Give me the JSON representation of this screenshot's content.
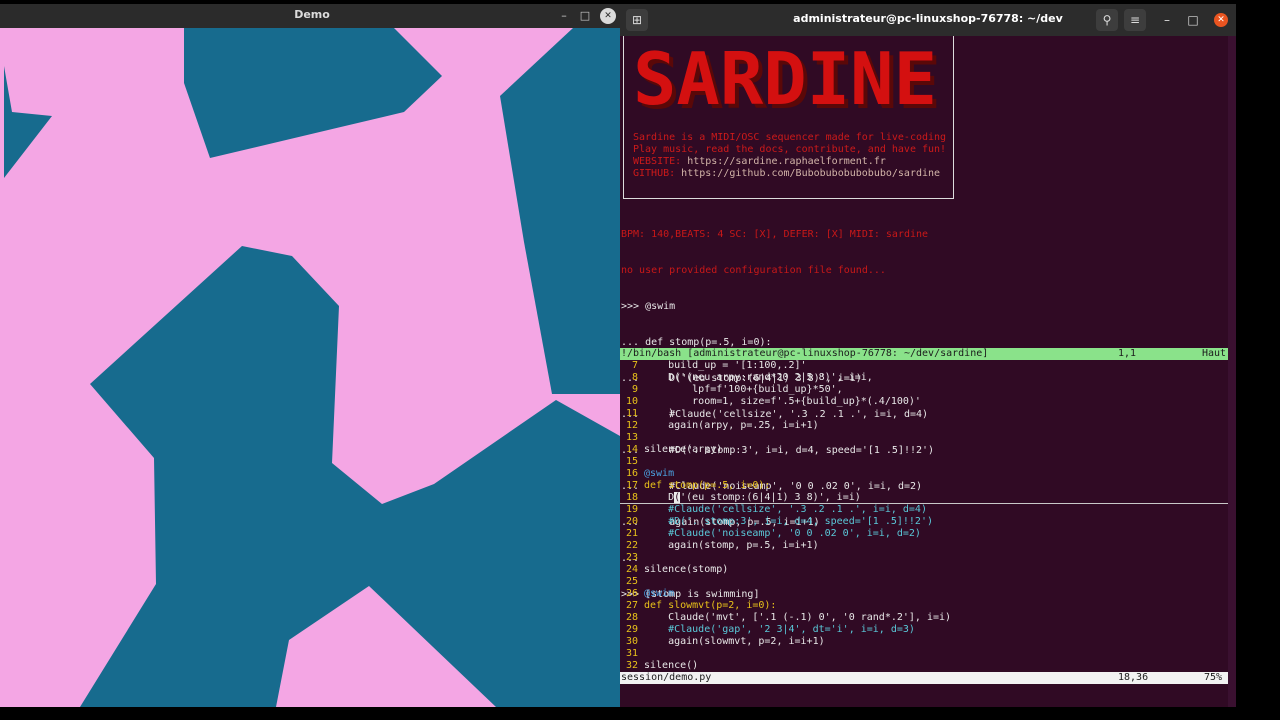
{
  "demo_window": {
    "title": "Demo",
    "minimize_glyph": "–",
    "maximize_glyph": "□",
    "close_glyph": "✕",
    "colors": {
      "background": "#f4a6e4",
      "shape": "#176b8e"
    }
  },
  "terminal_window": {
    "title": "administrateur@pc-linuxshop-76778: ~/dev",
    "new_tab_glyph": "⊞",
    "search_glyph": "⚲",
    "menu_glyph": "≡",
    "minimize_glyph": "–",
    "maximize_glyph": "□",
    "close_glyph": "✕",
    "colors": {
      "background": "#300a24",
      "close_button": "#e95420"
    }
  },
  "banner": {
    "logo_text": "SARDINE",
    "line1": "Sardine is a MIDI/OSC sequencer made for live-coding",
    "line2": "Play music, read the docs, contribute, and have fun!",
    "website_label": "WEBSITE: ",
    "website_url": "https://sardine.raphaelforment.fr",
    "github_label": "GITHUB: ",
    "github_url": "https://github.com/Bubobubobubobubo/sardine"
  },
  "repl": {
    "lines": [
      "BPM: 140,BEATS: 4 SC: [X], DEFER: [X] MIDI: sardine",
      "no user provided configuration file found...",
      ">>> @swim",
      "... def stomp(p=.5, i=0):",
      "...     D('(eu stomp:(6|4|1) 3 8)', i=i)",
      "...     #Claude('cellsize', '.3 .2 .1 .', i=i, d=4)",
      "...     #D('. stomp:3', i=i, d=4, speed='[1 .5]!!2')",
      "...     #Claude('noiseamp', '0 0 .02 0', i=i, d=2)",
      "...     again(stomp, p=.5, i=i+1)",
      "...",
      ">>> [stomp is swimming]"
    ]
  },
  "status_top": {
    "path": "!/bin/bash [administrateur@pc-linuxshop-76778: ~/dev/sardine]",
    "position": "1,1",
    "scroll": "Haut"
  },
  "editor": {
    "lines": [
      {
        "n": "7",
        "code": "    build_up = '[1:100,.2]'"
      },
      {
        "n": "8",
        "code": "    D('(neu arpy:rand*20 2|5 8)', i=i,"
      },
      {
        "n": "9",
        "code": "        lpf=f'100+{build_up}*50',"
      },
      {
        "n": "10",
        "code": "        room=1, size=f'.5+{build_up}*(.4/100)'"
      },
      {
        "n": "11",
        "code": "    )"
      },
      {
        "n": "12",
        "code": "    again(arpy, p=.25, i=i+1)"
      },
      {
        "n": "13",
        "code": ""
      },
      {
        "n": "14",
        "code": "silence(arpy)"
      },
      {
        "n": "15",
        "code": ""
      },
      {
        "n": "16",
        "code": "@swim"
      },
      {
        "n": "17",
        "code": "def stomp(p=.5, i=0):"
      },
      {
        "n": "18",
        "code": "    D('(eu stomp:(6|4|1) 3 8)', i=i)"
      },
      {
        "n": "19",
        "code": "    #Claude('cellsize', '.3 .2 .1 .', i=i, d=4)"
      },
      {
        "n": "20",
        "code": "    #D('. stomp:3', i=i, d=4, speed='[1 .5]!!2')"
      },
      {
        "n": "21",
        "code": "    #Claude('noiseamp', '0 0 .02 0', i=i, d=2)"
      },
      {
        "n": "22",
        "code": "    again(stomp, p=.5, i=i+1)"
      },
      {
        "n": "23",
        "code": ""
      },
      {
        "n": "24",
        "code": "silence(stomp)"
      },
      {
        "n": "25",
        "code": ""
      },
      {
        "n": "26",
        "code": "@swim"
      },
      {
        "n": "27",
        "code": "def slowmvt(p=2, i=0):"
      },
      {
        "n": "28",
        "code": "    Claude('mvt', ['.1 (-.1) 0', '0 rand*.2'], i=i)"
      },
      {
        "n": "29",
        "code": "    #Claude('gap', '2 3|4', dt='i', i=i, d=3)"
      },
      {
        "n": "30",
        "code": "    again(slowmvt, p=2, i=i+1)"
      },
      {
        "n": "31",
        "code": ""
      },
      {
        "n": "32",
        "code": "silence()"
      }
    ]
  },
  "status_bottom": {
    "file": "session/demo.py",
    "position": "18,36",
    "scroll": "75%"
  }
}
